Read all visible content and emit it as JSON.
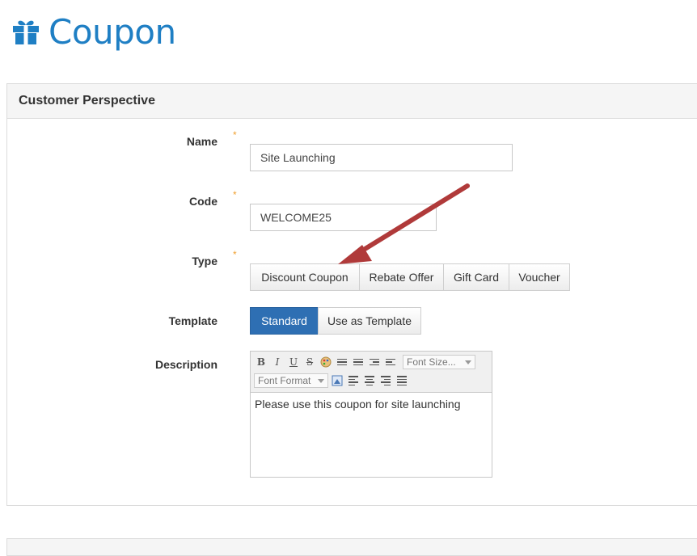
{
  "page": {
    "title": "Coupon",
    "icon": "gift-icon"
  },
  "panel": {
    "heading": "Customer Perspective"
  },
  "form": {
    "name": {
      "label": "Name",
      "value": "Site Launching",
      "required": "*"
    },
    "code": {
      "label": "Code",
      "value": "WELCOME25",
      "required": "*"
    },
    "type": {
      "label": "Type",
      "required": "*",
      "options": [
        "Discount Coupon",
        "Rebate Offer",
        "Gift Card",
        "Voucher"
      ]
    },
    "template": {
      "label": "Template",
      "options": [
        "Standard",
        "Use as Template"
      ],
      "selected": "Standard"
    },
    "description": {
      "label": "Description",
      "toolbar": {
        "bold": "B",
        "italic": "I",
        "underline": "U",
        "strike": "S",
        "font_size": "Font Size...",
        "font_format": "Font Format"
      },
      "value": "Please use this coupon for site launching"
    }
  },
  "colors": {
    "accent": "#1f7fc4",
    "active_button": "#2e6fb3",
    "required": "#f0a030",
    "arrow": "#b03a3a"
  }
}
